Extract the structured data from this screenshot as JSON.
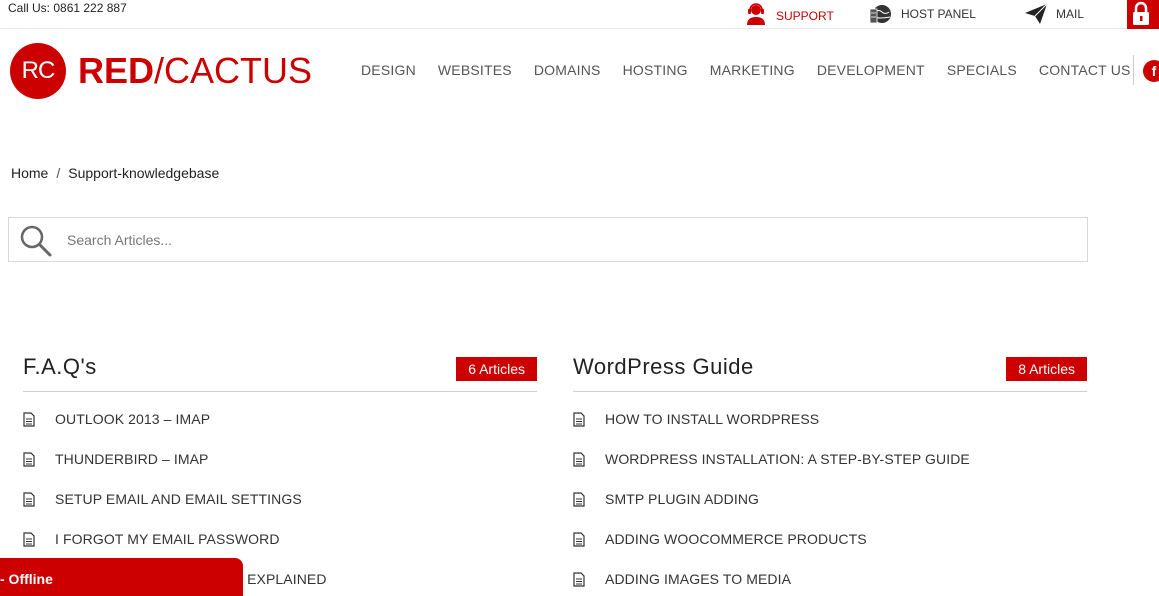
{
  "topbar": {
    "call": "Call Us: 0861 222 887",
    "support": {
      "label": "SUPPORT",
      "icon": "support-agent-icon"
    },
    "host_panel": {
      "label": "HOST PANEL",
      "icon": "server-globe-icon"
    },
    "mail": {
      "label": "MAIL",
      "icon": "paper-plane-icon"
    },
    "lock": {
      "icon": "lock-icon"
    }
  },
  "logo": {
    "mark": "RC",
    "red": "RED",
    "slash": "/",
    "cactus": "CACTUS"
  },
  "nav": [
    "DESIGN",
    "WEBSITES",
    "DOMAINS",
    "HOSTING",
    "MARKETING",
    "DEVELOPMENT",
    "SPECIALS",
    "CONTACT US"
  ],
  "social": {
    "facebook": "f"
  },
  "breadcrumb": {
    "home": "Home",
    "separator": "/",
    "current": "Support-knowledgebase"
  },
  "search": {
    "placeholder": "Search Articles..."
  },
  "categories": [
    {
      "title": "F.A.Q's",
      "count": "6 Articles",
      "articles": [
        "OUTLOOK 2013 – IMAP",
        "THUNDERBIRD – IMAP",
        "SETUP EMAIL AND EMAIL SETTINGS",
        "I FORGOT MY EMAIL PASSWORD",
        "DES EXPLAINED"
      ]
    },
    {
      "title": "WordPress Guide",
      "count": "8 Articles",
      "articles": [
        "HOW TO INSTALL WORDPRESS",
        "WORDPRESS INSTALLATION: A STEP-BY-STEP GUIDE",
        "SMTP PLUGIN ADDING",
        "ADDING WOOCOMMERCE PRODUCTS",
        "ADDING IMAGES TO MEDIA"
      ]
    }
  ],
  "chat": {
    "status": "- Offline"
  },
  "colors": {
    "brand_red": "#cc0000",
    "text": "#333333",
    "border": "#d8d8d8"
  }
}
